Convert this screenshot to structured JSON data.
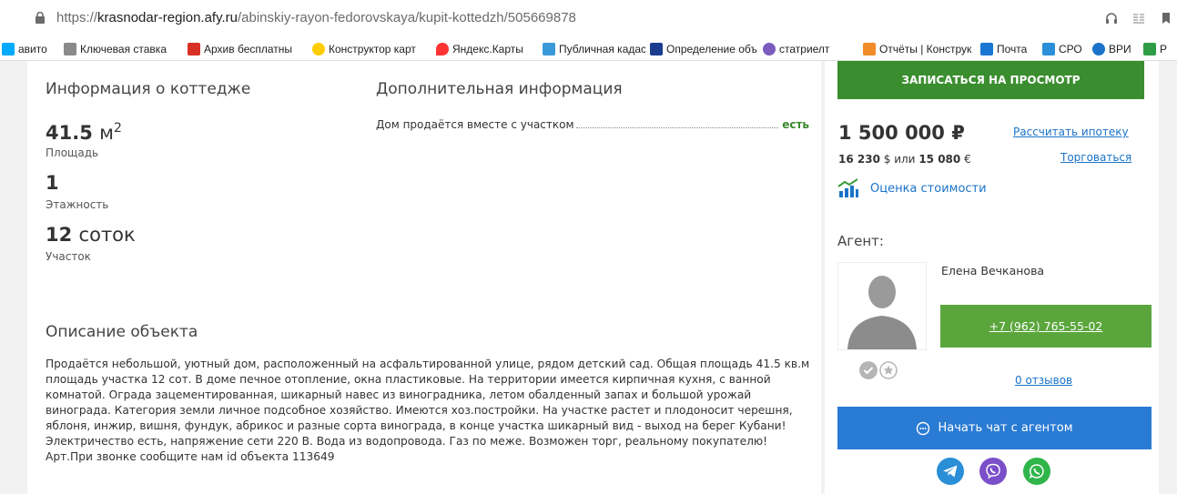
{
  "browser": {
    "url_prefix": "https://",
    "url_host": "krasnodar-region.afy.ru",
    "url_path": "/abinskiy-rayon-fedorovskaya/kupit-kottedzh/505669878"
  },
  "bookmarks": [
    {
      "label": "авито",
      "color": "#00aaff"
    },
    {
      "label": "Ключевая ставка",
      "color": "#8a8a8a"
    },
    {
      "label": "Архив бесплатны",
      "color": "#d93025"
    },
    {
      "label": "Конструктор карт",
      "color": "#ffcc00"
    },
    {
      "label": "Яндекс.Карты",
      "color": "#ff3333"
    },
    {
      "label": "Публичная кадаст",
      "color": "#3a9ad9"
    },
    {
      "label": "Определение объ",
      "color": "#1a3d8f"
    },
    {
      "label": "статриелт",
      "color": "#7c5cbf"
    },
    {
      "label": "Отчёты | Конструк",
      "color": "#f28c28"
    },
    {
      "label": "Почта",
      "color": "#1976d2"
    },
    {
      "label": "СРО",
      "color": "#2b8fd8"
    },
    {
      "label": "ВРИ",
      "color": "#1a73c9"
    },
    {
      "label": "P",
      "color": "#2e9d46"
    }
  ],
  "cottage_info": {
    "heading": "Информация о коттедже",
    "area_value": "41.5",
    "area_unit": "м",
    "area_sup": "2",
    "area_label": "Площадь",
    "floors_value": "1",
    "floors_label": "Этажность",
    "plot_value": "12",
    "plot_unit": "соток",
    "plot_label": "Участок"
  },
  "additional": {
    "heading": "Дополнительная информация",
    "row_label": "Дом продаётся вместе с участком",
    "row_value": "есть"
  },
  "description": {
    "heading": "Описание объекта",
    "text": "Продаётся небольшой, уютный дом, расположенный на асфальтированной улице, рядом детский сад. Общая площадь 41.5 кв.м площадь участка 12 сот. В доме печное отопление, окна пластиковые. На территории имеется кирпичная кухня, с ванной комнатой. Ограда зацементированная, шикарный навес из виноградника, летом обалденный запах и большой урожай винограда. Категория земли личное подсобное хозяйство. Имеются хоз.постройки. На участке растет и плодоносит черешня, яблоня, инжир, вишня, фундук, абрикос и разные сорта винограда, в конце участка шикарный вид - выход на берег Кубани! Электричество есть, напряжение сети 220 В. Вода из водопровода. Газ по меже. Возможен торг, реальному покупателю!",
    "article_note": "Арт.При звонке сообщите нам id объекта 113649"
  },
  "sidebar": {
    "schedule_button": "ЗАПИСАТЬСЯ НА ПРОСМОТР",
    "price": "1 500 000 ₽",
    "price_usd": "16 230",
    "usd_sign": "$ или",
    "price_eur": "15 080",
    "eur_sign": "€",
    "mortgage_link": "Рассчитать ипотеку",
    "bargain_link": "Торговаться",
    "valuation_link": "Оценка стоимости",
    "agent_heading": "Агент:",
    "agent_name": "Елена Вечканова",
    "phone": "+7 (962) 765-55-02",
    "reviews_link": "0 отзывов",
    "chat_button": "Начать чат с агентом"
  }
}
